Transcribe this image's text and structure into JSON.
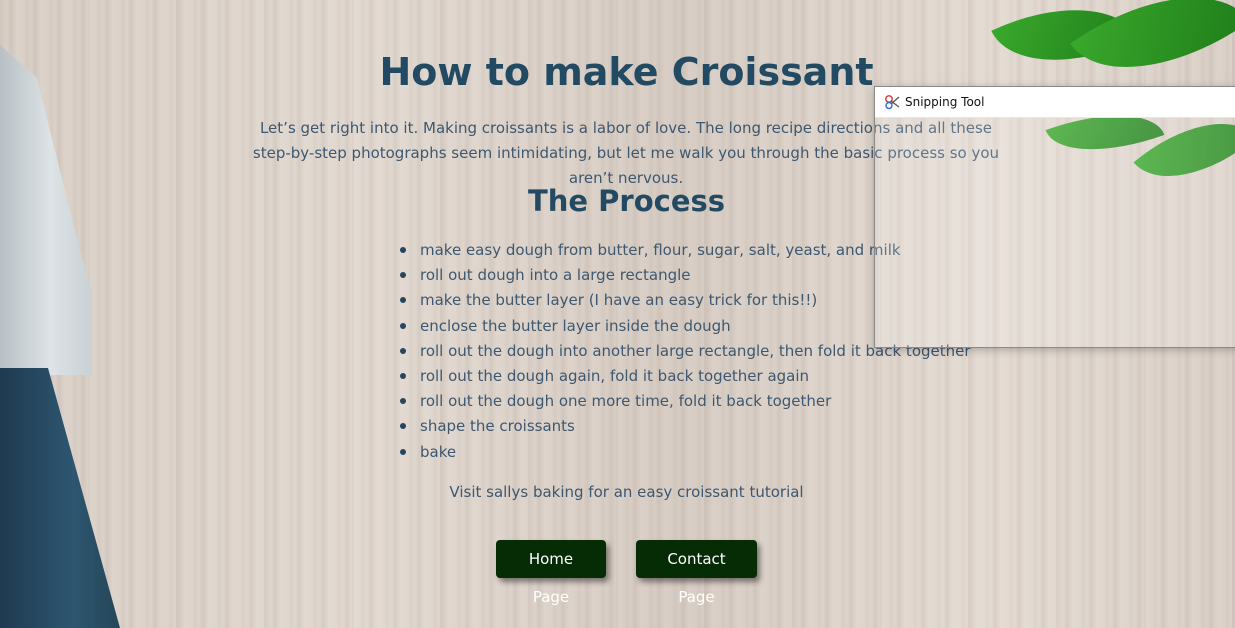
{
  "page": {
    "title": "How to make Croissant",
    "intro": "Let’s get right into it. Making croissants is a labor of love. The long recipe directions and all these step-by-step photographs seem intimidating, but let me walk you through the basic process so you aren’t nervous.",
    "section_title": "The Process",
    "steps": [
      "make easy dough from butter, flour, sugar, salt, yeast, and milk",
      "roll out dough into a large rectangle",
      "make the butter layer (I have an easy trick for this!!)",
      "enclose the butter layer inside the dough",
      "roll out the dough into another large rectangle, then fold it back together",
      "roll out the dough again, fold it back together again",
      "roll out the dough one more time, fold it back together",
      "shape the croissants",
      "bake"
    ],
    "visit_text": "Visit sallys baking for an easy croissant tutorial",
    "buttons": {
      "home": "Home Page",
      "contact": "Contact Page"
    }
  },
  "snipping_tool": {
    "title": "Snipping Tool",
    "icon": "scissors-icon"
  },
  "colors": {
    "heading": "#234a63",
    "body_text": "#3d5870",
    "button_bg": "#062c06",
    "button_text": "#ffffff"
  }
}
